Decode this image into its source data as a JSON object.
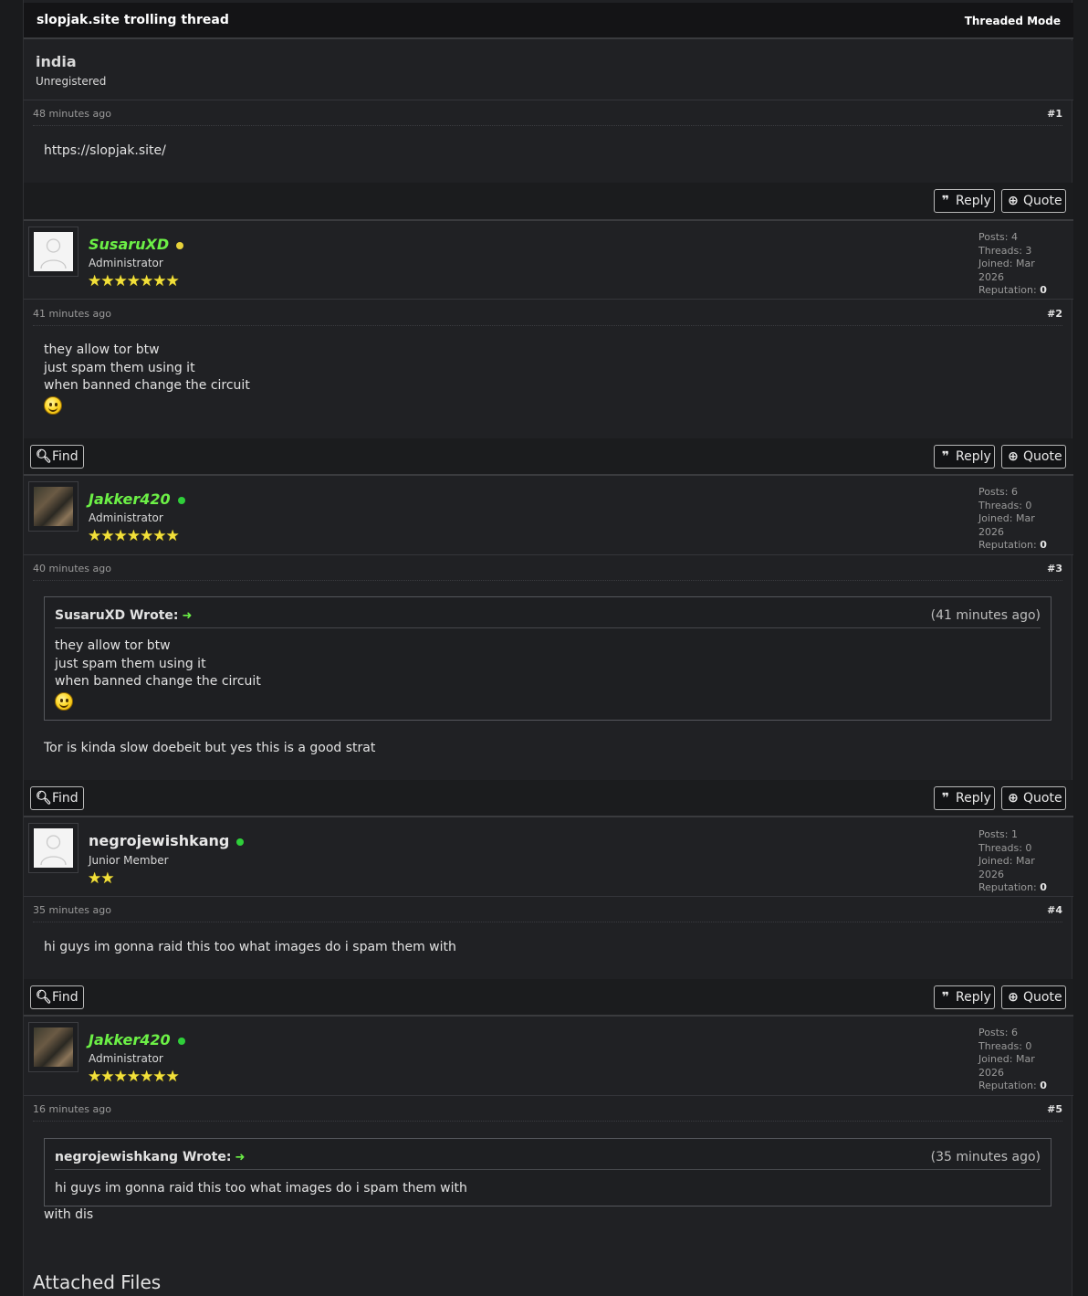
{
  "thread": {
    "title": "slopjak.site trolling thread",
    "mode": "Threaded Mode"
  },
  "labels": {
    "find": "Find",
    "reply": "Reply",
    "quote": "Quote",
    "posts": "Posts:",
    "threads": "Threads:",
    "joined": "Joined:",
    "reputation": "Reputation:",
    "attached_files": "Attached Files"
  },
  "posts": [
    {
      "author": {
        "name": "india",
        "group": "Unregistered"
      },
      "time": "48 minutes ago",
      "number": "#1",
      "lines": [
        "https://slopjak.site/"
      ]
    },
    {
      "author": {
        "name": "SusaruXD",
        "group": "Administrator",
        "status": "away",
        "stars": "★★★★★★★",
        "posts": "4",
        "threads": "3",
        "joined": "Mar 2026",
        "reputation": "0"
      },
      "time": "41 minutes ago",
      "number": "#2",
      "lines": [
        "they allow tor btw",
        "just spam them using it",
        "when banned change the circuit"
      ]
    },
    {
      "author": {
        "name": "Jakker420",
        "group": "Administrator",
        "status": "online",
        "stars": "★★★★★★★",
        "posts": "6",
        "threads": "0",
        "joined": "Mar 2026",
        "reputation": "0"
      },
      "time": "40 minutes ago",
      "number": "#3",
      "quote": {
        "who": "SusaruXD Wrote:",
        "when": "(41 minutes ago)",
        "lines": [
          "they allow tor btw",
          "just spam them using it",
          "when banned change the circuit"
        ]
      },
      "lines": [
        "Tor is kinda slow doebeit but yes this is a good strat"
      ]
    },
    {
      "author": {
        "name": "negrojewishkang",
        "group": "Junior Member",
        "status": "online",
        "stars": "★★",
        "posts": "1",
        "threads": "0",
        "joined": "Mar 2026",
        "reputation": "0"
      },
      "time": "35 minutes ago",
      "number": "#4",
      "lines": [
        "hi guys im gonna raid this too what images do i spam them with"
      ]
    },
    {
      "author": {
        "name": "Jakker420",
        "group": "Administrator",
        "status": "online",
        "stars": "★★★★★★★",
        "posts": "6",
        "threads": "0",
        "joined": "Mar 2026",
        "reputation": "0"
      },
      "time": "16 minutes ago",
      "number": "#5",
      "quote": {
        "who": "negrojewishkang Wrote:",
        "when": "(35 minutes ago)",
        "lines": [
          "hi guys im gonna raid this too what images do i spam them with"
        ]
      },
      "lines": [
        "with dis"
      ]
    }
  ],
  "icons": {
    "find": "search-icon",
    "reply": "quote-marks-icon",
    "quote": "plus-circle-icon",
    "quote_link": "arrow-right-icon",
    "smiley": "smiley-icon"
  },
  "colors": {
    "admin_name": "#6cf046",
    "online": "#2fcf3a",
    "away": "#e8d23a",
    "stars": "#f2e03a"
  }
}
